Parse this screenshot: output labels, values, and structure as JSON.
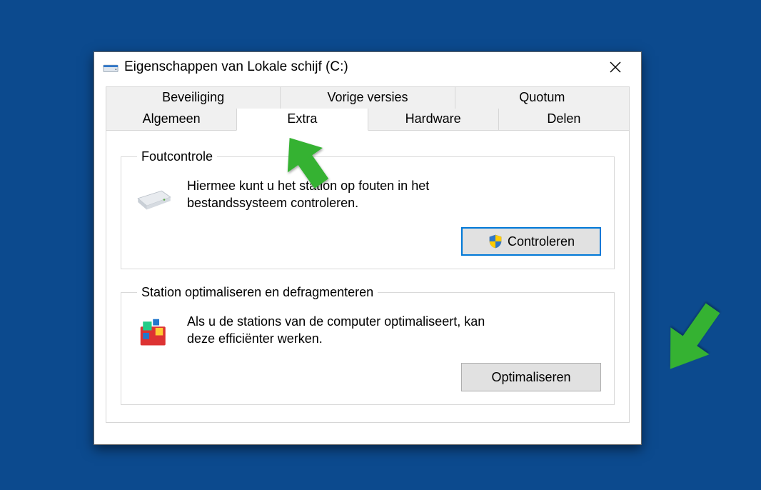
{
  "window": {
    "title": "Eigenschappen van Lokale schijf (C:)"
  },
  "tabs": {
    "row1": [
      "Beveiliging",
      "Vorige versies",
      "Quotum"
    ],
    "row2": [
      "Algemeen",
      "Extra",
      "Hardware",
      "Delen"
    ],
    "active": "Extra"
  },
  "groups": {
    "errorCheck": {
      "legend": "Foutcontrole",
      "text": "Hiermee kunt u het station op fouten in het bestandssysteem controleren.",
      "button": "Controleren"
    },
    "optimize": {
      "legend": "Station optimaliseren en defragmenteren",
      "text": "Als u de stations van de computer optimaliseert, kan deze efficiënter werken.",
      "button": "Optimaliseren"
    }
  }
}
